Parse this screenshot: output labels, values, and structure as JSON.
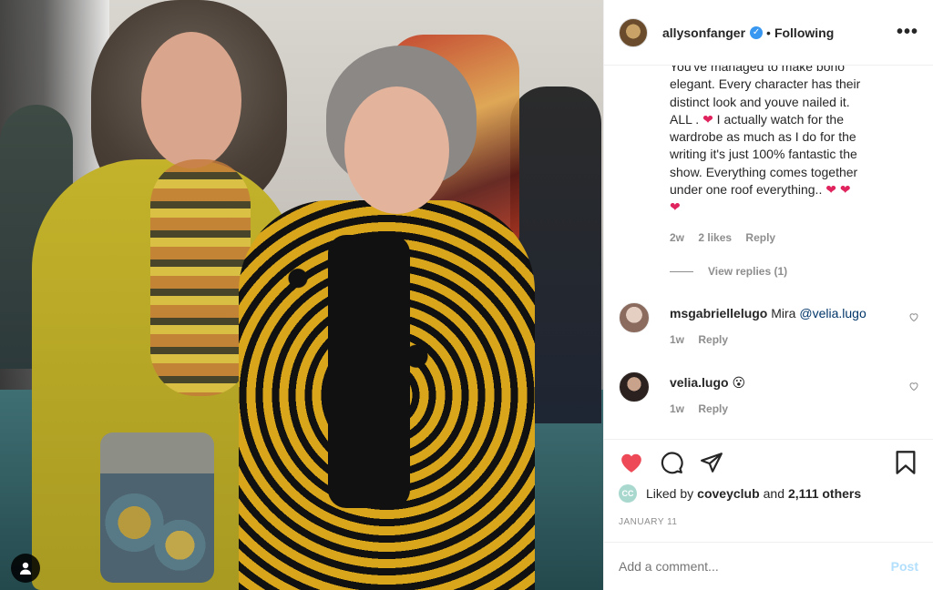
{
  "post": {
    "photo_user_tag_icon": "user-icon"
  },
  "header": {
    "username": "allysonfanger",
    "verified_icon": "verified-badge-icon",
    "separator": "•",
    "follow_state": "Following",
    "more_icon": "more-options-icon",
    "more_label": "•••"
  },
  "caption_comment": {
    "text_lines": [
      "You've managed to make bono",
      "elegant. Every character has their",
      "distinct look and youve nailed it.",
      "ALL . ❤ I actually watch for the",
      "wardrobe as much as I do for the",
      "writing it's just 100% fantastic the",
      "show. Everything comes together",
      "under one roof everything.. ❤ ❤",
      "❤"
    ],
    "time": "2w",
    "likes": "2 likes",
    "reply": "Reply",
    "view_replies": "View replies (1)"
  },
  "comments": [
    {
      "username": "msgabriellelugo",
      "text": "Mira",
      "mention": "@velia.lugo",
      "time": "1w",
      "reply": "Reply",
      "like_icon": "heart-outline-icon"
    },
    {
      "username": "velia.lugo",
      "text": "😮",
      "mention": "",
      "time": "1w",
      "reply": "Reply",
      "like_icon": "heart-outline-icon"
    }
  ],
  "actions": {
    "like_icon": "heart-filled-icon",
    "comment_icon": "comment-icon",
    "share_icon": "share-icon",
    "save_icon": "bookmark-icon"
  },
  "likes": {
    "avatar_initials": "CC",
    "prefix": "Liked by",
    "user": "coveyclub",
    "conj": "and",
    "others": "2,111 others"
  },
  "date": "JANUARY 11",
  "add_comment": {
    "placeholder": "Add a comment...",
    "post_label": "Post"
  },
  "colors": {
    "like_red": "#ed4956",
    "verified_blue": "#3897f0",
    "post_disabled": "#b2dffc",
    "mention_blue": "#003569"
  }
}
